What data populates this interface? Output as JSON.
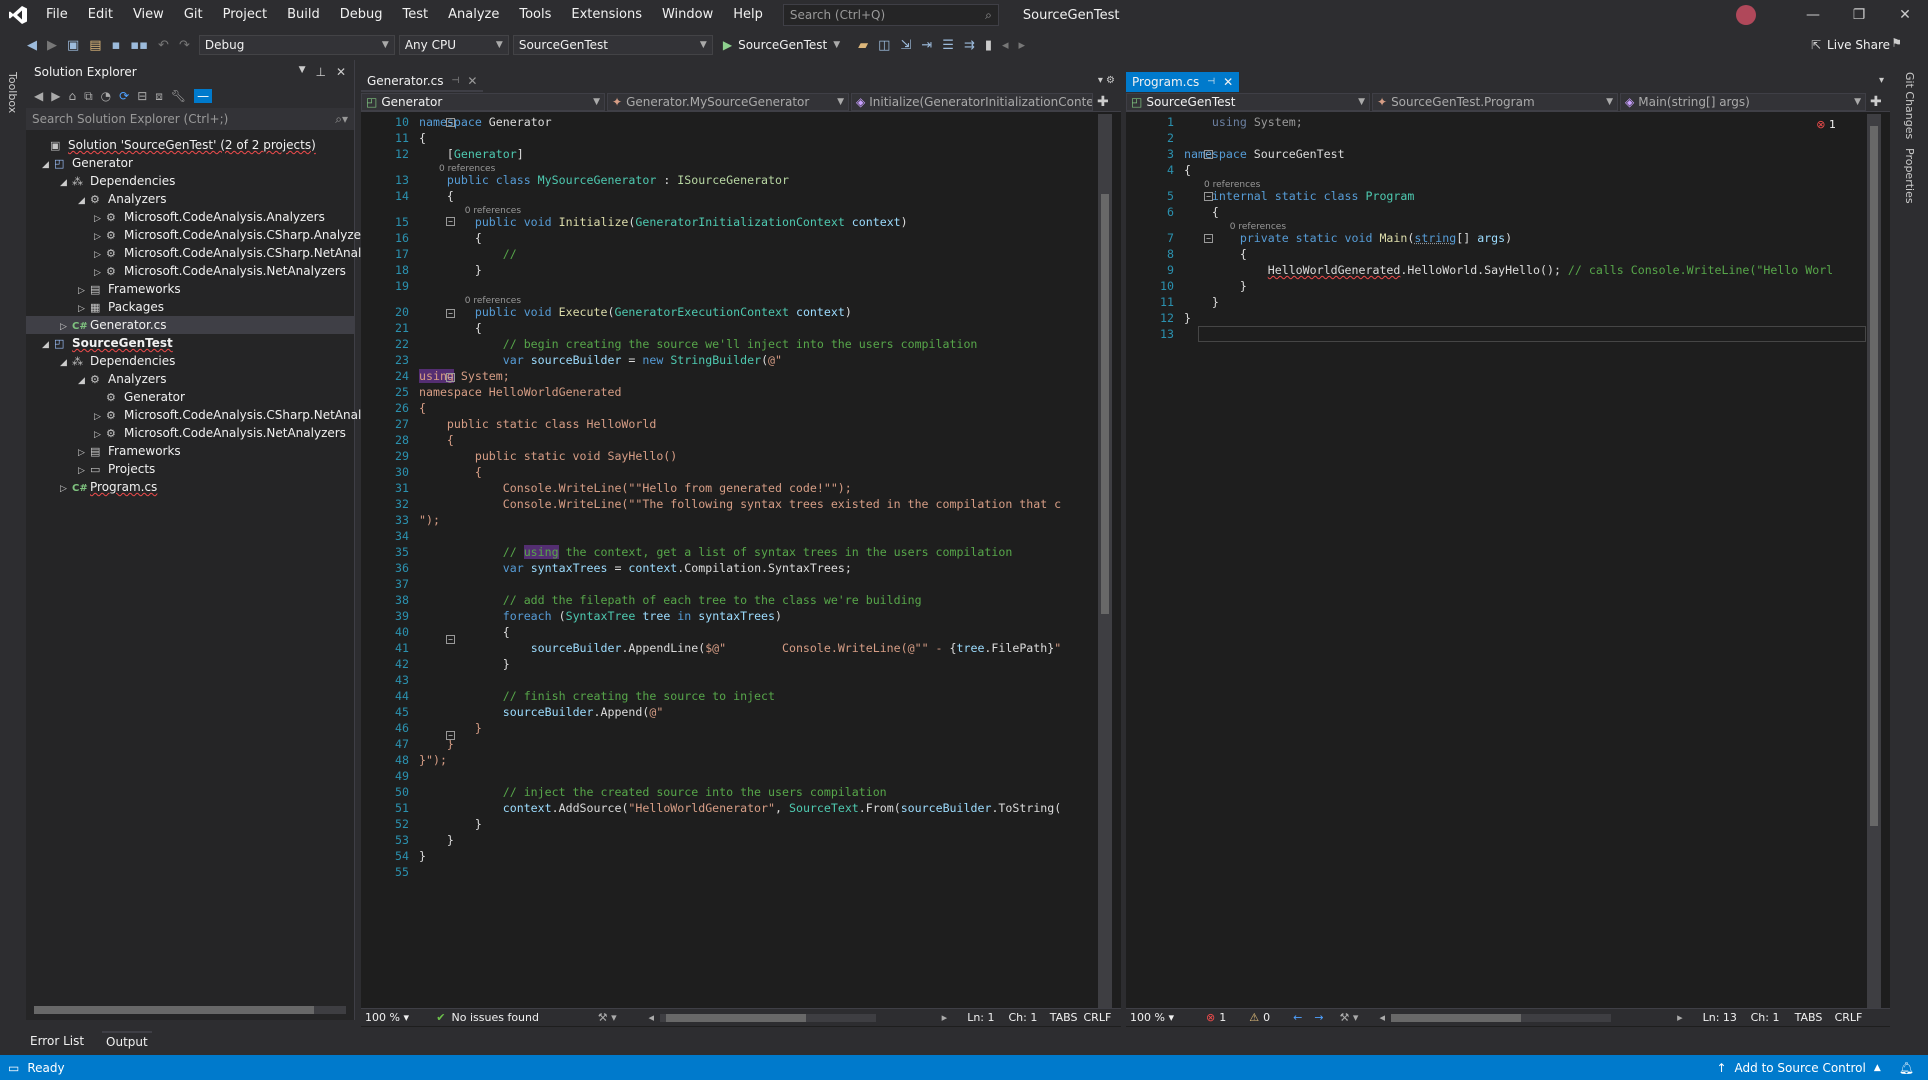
{
  "menu": {
    "items": [
      "File",
      "Edit",
      "View",
      "Git",
      "Project",
      "Build",
      "Debug",
      "Test",
      "Analyze",
      "Tools",
      "Extensions",
      "Window",
      "Help"
    ],
    "search_placeholder": "Search (Ctrl+Q)",
    "window_title": "SourceGenTest"
  },
  "toolbar": {
    "config": "Debug",
    "platform": "Any CPU",
    "startup_project": "SourceGenTest",
    "run_label": "SourceGenTest",
    "live_share": "Live Share"
  },
  "side_labels": {
    "toolbox": "Toolbox",
    "git_changes": "Git Changes",
    "properties": "Properties"
  },
  "solution_explorer": {
    "title": "Solution Explorer",
    "search_placeholder": "Search Solution Explorer (Ctrl+;)",
    "rows": [
      {
        "label": "Solution 'SourceGenTest' (2 of 2 projects)",
        "icon": "solution-icon",
        "squiggle": true
      },
      {
        "label": "Generator",
        "icon": "csharp-project-icon",
        "expander": "▲"
      },
      {
        "label": "Dependencies",
        "icon": "dependencies-icon",
        "expander": "▲"
      },
      {
        "label": "Analyzers",
        "icon": "analyzer-icon",
        "expander": "▲"
      },
      {
        "label": "Microsoft.CodeAnalysis.Analyzers",
        "icon": "analyzer-icon",
        "expander": "▷"
      },
      {
        "label": "Microsoft.CodeAnalysis.CSharp.Analyzers",
        "icon": "analyzer-icon",
        "expander": "▷"
      },
      {
        "label": "Microsoft.CodeAnalysis.CSharp.NetAnalyzers",
        "icon": "analyzer-icon",
        "expander": "▷"
      },
      {
        "label": "Microsoft.CodeAnalysis.NetAnalyzers",
        "icon": "analyzer-icon",
        "expander": "▷"
      },
      {
        "label": "Frameworks",
        "icon": "framework-icon",
        "expander": "▷"
      },
      {
        "label": "Packages",
        "icon": "package-icon",
        "expander": "▷"
      },
      {
        "label": "Generator.cs",
        "icon": "csharp-file-icon",
        "expander": "▷",
        "selected": true
      },
      {
        "label": "SourceGenTest",
        "icon": "csharp-project-icon",
        "expander": "▲",
        "bold": true,
        "squiggle": true
      },
      {
        "label": "Dependencies",
        "icon": "dependencies-icon",
        "expander": "▲"
      },
      {
        "label": "Analyzers",
        "icon": "analyzer-icon",
        "expander": "▲"
      },
      {
        "label": "Generator",
        "icon": "analyzer-icon",
        "expander": ""
      },
      {
        "label": "Microsoft.CodeAnalysis.CSharp.NetAnalyzers",
        "icon": "analyzer-icon",
        "expander": "▷"
      },
      {
        "label": "Microsoft.CodeAnalysis.NetAnalyzers",
        "icon": "analyzer-icon",
        "expander": "▷"
      },
      {
        "label": "Frameworks",
        "icon": "framework-icon",
        "expander": "▷"
      },
      {
        "label": "Projects",
        "icon": "projects-icon",
        "expander": "▷"
      },
      {
        "label": "Program.cs",
        "icon": "csharp-file-icon",
        "expander": "▷",
        "squiggle": true
      }
    ]
  },
  "left_editor": {
    "tab": "Generator.cs",
    "nav": [
      "Generator",
      "Generator.MySourceGenerator",
      "Initialize(GeneratorInitializationContext"
    ],
    "zoom": "100 %",
    "issues": "No issues found",
    "ln": "Ln: 1",
    "ch": "Ch: 1",
    "tabs": "TABS",
    "eol": "CRLF"
  },
  "right_editor": {
    "tab": "Program.cs",
    "nav": [
      "SourceGenTest",
      "SourceGenTest.Program",
      "Main(string[] args)"
    ],
    "zoom": "100 %",
    "errors": "1",
    "warnings": "0",
    "ln": "Ln: 13",
    "ch": "Ch: 1",
    "tabs": "TABS",
    "eol": "CRLF",
    "error_marker": "1"
  },
  "bottom_tabs": [
    "Error List",
    "Output"
  ],
  "status": {
    "ready": "Ready",
    "source_control": "Add to Source Control"
  },
  "colors": {
    "accent": "#007acc",
    "keyword": "#569cd6",
    "type": "#4ec9b0",
    "string": "#d69d85",
    "comment": "#57a64a"
  }
}
